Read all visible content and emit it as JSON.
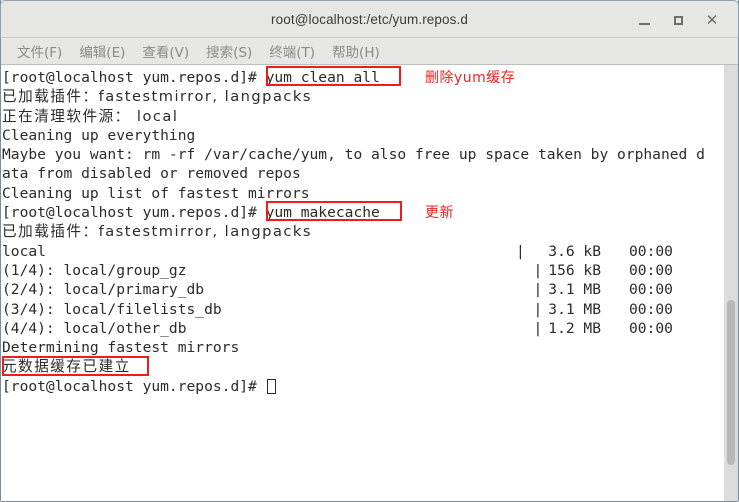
{
  "window": {
    "title": "root@localhost:/etc/yum.repos.d",
    "controls": {
      "minimize_label": "_",
      "maximize_label": "□",
      "close_label": "✕"
    }
  },
  "menubar": {
    "items": [
      {
        "label": "文件(F)"
      },
      {
        "label": "编辑(E)"
      },
      {
        "label": "查看(V)"
      },
      {
        "label": "搜索(S)"
      },
      {
        "label": "终端(T)"
      },
      {
        "label": "帮助(H)"
      }
    ]
  },
  "terminal": {
    "prompt": "[root@localhost yum.repos.d]# ",
    "lines": [
      {
        "id": "l01",
        "text": "[root@localhost yum.repos.d]# yum clean all"
      },
      {
        "id": "l02",
        "text": "已加载插件：fastestmirror, langpacks"
      },
      {
        "id": "l03",
        "text": "正在清理软件源： local"
      },
      {
        "id": "l04",
        "text": "Cleaning up everything"
      },
      {
        "id": "l05",
        "text": "Maybe you want: rm -rf /var/cache/yum, to also free up space taken by orphaned d"
      },
      {
        "id": "l06",
        "text": "ata from disabled or removed repos"
      },
      {
        "id": "l07",
        "text": "Cleaning up list of fastest mirrors"
      },
      {
        "id": "l08",
        "text": "[root@localhost yum.repos.d]# yum makecache"
      },
      {
        "id": "l09",
        "text": "已加载插件：fastestmirror, langpacks"
      },
      {
        "id": "l10",
        "text": "local"
      },
      {
        "id": "l11",
        "text": "(1/4): local/group_gz"
      },
      {
        "id": "l12",
        "text": "(2/4): local/primary_db"
      },
      {
        "id": "l13",
        "text": "(3/4): local/filelists_db"
      },
      {
        "id": "l14",
        "text": "(4/4): local/other_db"
      },
      {
        "id": "l15",
        "text": "Determining fastest mirrors"
      },
      {
        "id": "l16",
        "text": "元数据缓存已建立"
      },
      {
        "id": "l17",
        "text": "[root@localhost yum.repos.d]# "
      }
    ],
    "progress_rows": [
      {
        "bar": "|",
        "size": "3.6 kB",
        "time": "00:00"
      },
      {
        "bar": "|",
        "size": "156 kB",
        "time": "00:00"
      },
      {
        "bar": "|",
        "size": "3.1 MB",
        "time": "00:00"
      },
      {
        "bar": "|",
        "size": "3.1 MB",
        "time": "00:00"
      },
      {
        "bar": "|",
        "size": "1.2 MB",
        "time": "00:00"
      }
    ],
    "commands": {
      "clean": "yum clean all",
      "makecache": "yum makecache"
    }
  },
  "annotations": [
    {
      "id": "a1",
      "text": "删除yum缓存"
    },
    {
      "id": "a2",
      "text": "更新"
    }
  ],
  "colors": {
    "annotation_red": "#ee2222",
    "box_red": "#ee1c1c",
    "titlebar_bg": "#e6e6e4",
    "terminal_bg": "#ffffff",
    "terminal_fg": "#2b2b2b"
  }
}
